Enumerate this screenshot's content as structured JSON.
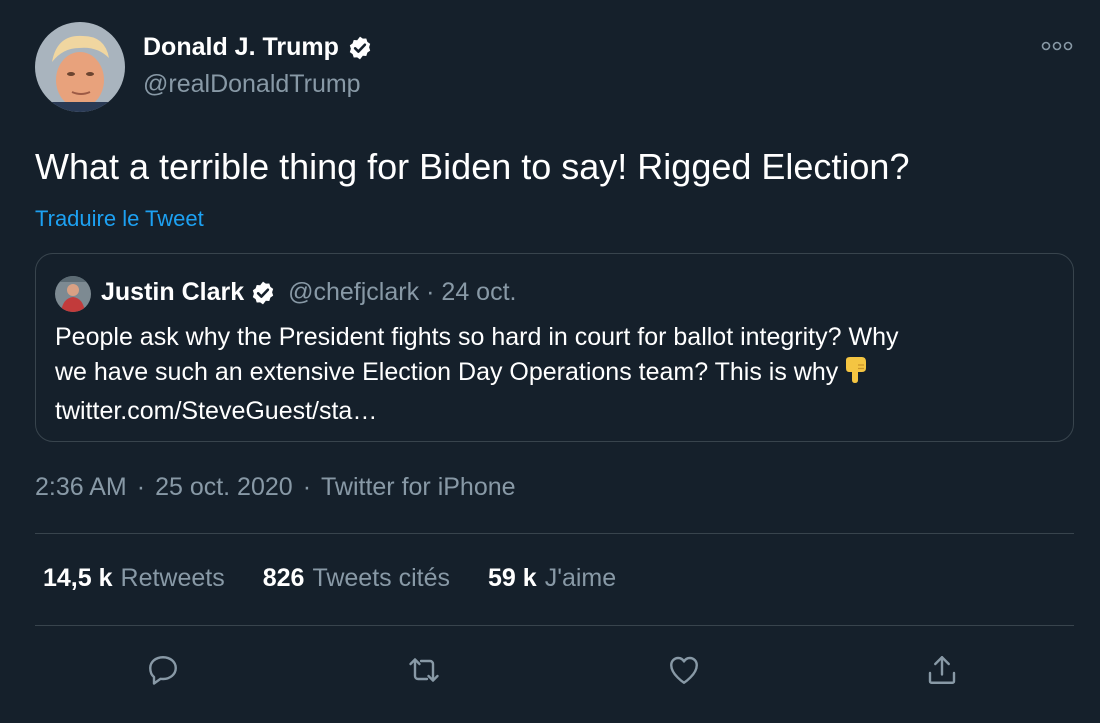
{
  "author": {
    "name": "Donald J. Trump",
    "handle": "@realDonaldTrump",
    "verified_icon": "verified-badge-icon"
  },
  "tweet": {
    "text": "What a terrible thing for Biden to say! Rigged Election?",
    "translate_label": "Traduire le Tweet"
  },
  "quoted": {
    "name": "Justin Clark",
    "handle": "@chefjclark",
    "separator": "·",
    "date": "24 oct.",
    "lines": [
      "People ask why the President fights so hard in court for ballot integrity?  Why",
      "we have such an extensive Election Day Operations team? This is why",
      "twitter.com/SteveGuest/sta…"
    ],
    "emoji_icon": "pointing-down-emoji-icon"
  },
  "meta": {
    "time": "2:36 AM",
    "date": "25 oct. 2020",
    "source": "Twitter for iPhone",
    "separator": "·"
  },
  "stats": {
    "retweets": {
      "count": "14,5 k",
      "label": "Retweets"
    },
    "quotes": {
      "count": "826",
      "label": "Tweets cités"
    },
    "likes": {
      "count": "59 k",
      "label": "J'aime"
    }
  },
  "actions": [
    "reply-icon",
    "retweet-icon",
    "like-icon",
    "share-icon"
  ],
  "colors": {
    "background": "#15202b",
    "text": "#ffffff",
    "secondary": "#8899a6",
    "accent": "#1da1f2",
    "border": "#38444d"
  }
}
